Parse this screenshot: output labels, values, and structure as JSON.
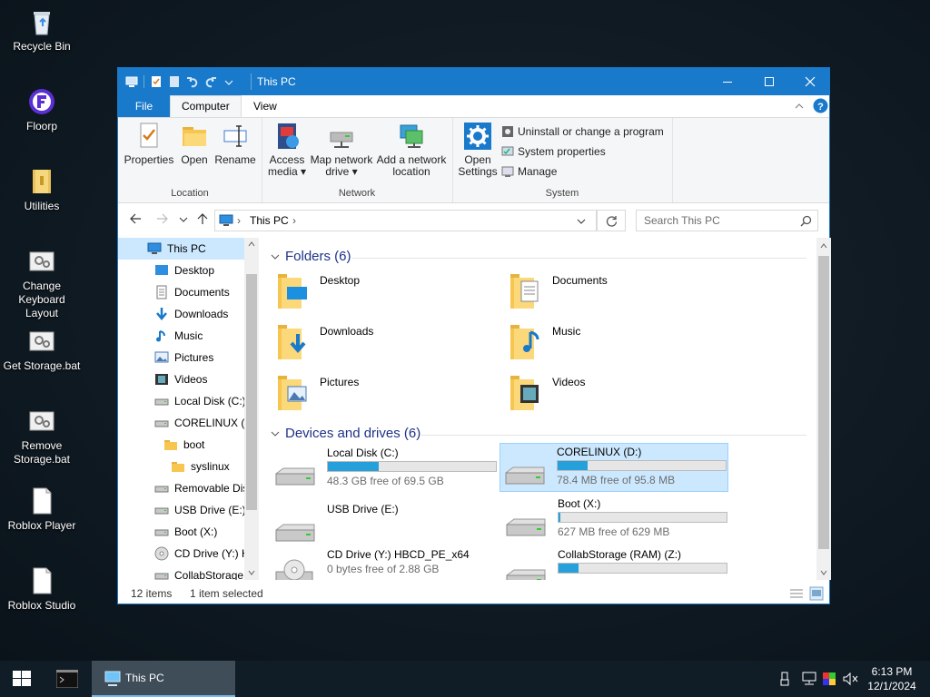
{
  "desktop": {
    "icons": [
      {
        "label": "Recycle Bin",
        "icon": "recycle-bin-icon"
      },
      {
        "label": "Floorp",
        "icon": "floorp-icon"
      },
      {
        "label": "Utilities",
        "icon": "folder-icon"
      },
      {
        "label": "Change Keyboard Layout",
        "icon": "settings-file-icon"
      },
      {
        "label": "Get Storage.bat",
        "icon": "settings-file-icon"
      },
      {
        "label": "Remove Storage.bat",
        "icon": "settings-file-icon"
      },
      {
        "label": "Roblox Player",
        "icon": "file-icon"
      },
      {
        "label": "Roblox Studio",
        "icon": "file-icon"
      }
    ]
  },
  "window": {
    "title": "This PC",
    "tabs": {
      "file": "File",
      "computer": "Computer",
      "view": "View"
    },
    "ribbon": {
      "location": {
        "label": "Location",
        "properties": "Properties",
        "open": "Open",
        "rename": "Rename"
      },
      "network": {
        "label": "Network",
        "access_media_1": "Access",
        "access_media_2": "media ▾",
        "map_drive_1": "Map network",
        "map_drive_2": "drive ▾",
        "add_location_1": "Add a network",
        "add_location_2": "location"
      },
      "system": {
        "label": "System",
        "open_settings_1": "Open",
        "open_settings_2": "Settings",
        "uninstall": "Uninstall or change a program",
        "system_properties": "System properties",
        "manage": "Manage"
      }
    },
    "address": {
      "path": "This PC",
      "search_placeholder": "Search This PC"
    },
    "nav": [
      {
        "label": "This PC",
        "indent": 0
      },
      {
        "label": "Desktop",
        "indent": 1
      },
      {
        "label": "Documents",
        "indent": 1
      },
      {
        "label": "Downloads",
        "indent": 1
      },
      {
        "label": "Music",
        "indent": 1
      },
      {
        "label": "Pictures",
        "indent": 1
      },
      {
        "label": "Videos",
        "indent": 1
      },
      {
        "label": "Local Disk (C:)",
        "indent": 1
      },
      {
        "label": "CORELINUX (D",
        "indent": 1
      },
      {
        "label": "boot",
        "indent": 2
      },
      {
        "label": "syslinux",
        "indent": 3
      },
      {
        "label": "Removable Dis",
        "indent": 1
      },
      {
        "label": "USB Drive (E:)",
        "indent": 1
      },
      {
        "label": "Boot (X:)",
        "indent": 1
      },
      {
        "label": "CD Drive (Y:) H",
        "indent": 1
      },
      {
        "label": "CollabStorage",
        "indent": 1
      }
    ],
    "folders_header": "Folders (6)",
    "folders": [
      "Desktop",
      "Documents",
      "Downloads",
      "Music",
      "Pictures",
      "Videos"
    ],
    "drives_header": "Devices and drives (6)",
    "drives": [
      {
        "name": "Local Disk (C:)",
        "info": "48.3 GB free of 69.5 GB",
        "used_fraction": 0.3,
        "selected": false
      },
      {
        "name": "CORELINUX (D:)",
        "info": "78.4 MB free of 95.8 MB",
        "used_fraction": 0.18,
        "selected": true
      },
      {
        "name": "USB Drive (E:)",
        "info": "",
        "used_fraction": null,
        "selected": false
      },
      {
        "name": "Boot (X:)",
        "info": "627 MB free of 629 MB",
        "used_fraction": 0.003,
        "selected": false
      },
      {
        "name": "CD Drive (Y:) HBCD_PE_x64",
        "info": "0 bytes free of 2.88 GB",
        "used_fraction": null,
        "selected": false
      },
      {
        "name": "CollabStorage (RAM) (Z:)",
        "info": "",
        "used_fraction": 0.12,
        "selected": false
      }
    ],
    "status": {
      "items": "12 items",
      "selected": "1 item selected"
    }
  },
  "taskbar": {
    "active_app": "This PC",
    "time": "6:13 PM",
    "date": "12/1/2024"
  },
  "colors": {
    "accent": "#1979ca",
    "drive_bar": "#26a0da",
    "selection": "#cce8ff"
  }
}
